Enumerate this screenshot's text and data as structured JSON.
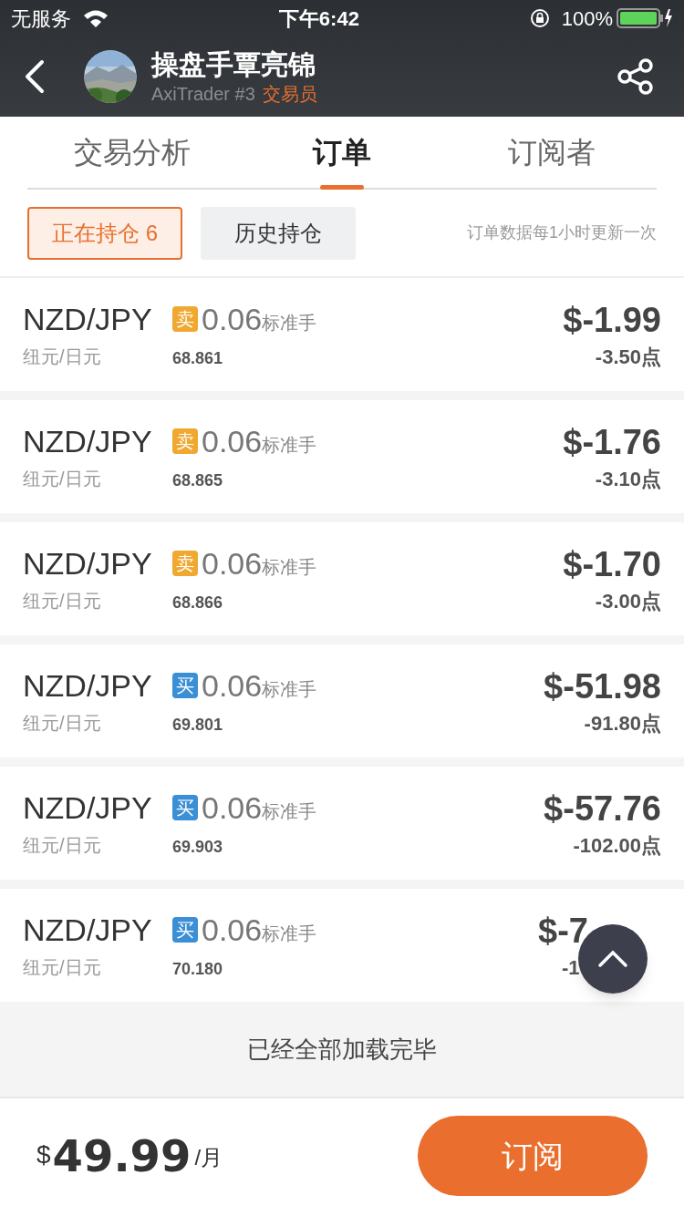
{
  "status_bar": {
    "carrier": "无服务",
    "time": "下午6:42",
    "battery": "100%"
  },
  "header": {
    "title": "操盘手覃亮锦",
    "subtitle": "AxiTrader #3",
    "role": "交易员"
  },
  "tabs": [
    {
      "label": "交易分析",
      "selected": false
    },
    {
      "label": "订单",
      "selected": true
    },
    {
      "label": "订阅者",
      "selected": false
    }
  ],
  "filters": [
    {
      "label": "正在持仓 6",
      "selected": true
    },
    {
      "label": "历史持仓",
      "selected": false
    }
  ],
  "update_note": "订单数据每1小时更新一次",
  "orders": [
    {
      "symbol": "NZD/JPY",
      "name": "纽元/日元",
      "color": "#f0a830",
      "badge": "卖",
      "lots": "0.06",
      "unit": "标准手",
      "price": "68.861",
      "pnl": "$-1.99",
      "points": "-3.50点"
    },
    {
      "symbol": "NZD/JPY",
      "name": "纽元/日元",
      "color": "#f0a830",
      "badge": "卖",
      "lots": "0.06",
      "unit": "标准手",
      "price": "68.865",
      "pnl": "$-1.76",
      "points": "-3.10点"
    },
    {
      "symbol": "NZD/JPY",
      "name": "纽元/日元",
      "color": "#f0a830",
      "badge": "卖",
      "lots": "0.06",
      "unit": "标准手",
      "price": "68.866",
      "pnl": "$-1.70",
      "points": "-3.00点"
    },
    {
      "symbol": "NZD/JPY",
      "name": "纽元/日元",
      "color": "#3b8fd4",
      "badge": "买",
      "lots": "0.06",
      "unit": "标准手",
      "price": "69.801",
      "pnl": "$-51.98",
      "points": "-91.80点"
    },
    {
      "symbol": "NZD/JPY",
      "name": "纽元/日元",
      "color": "#3b8fd4",
      "badge": "买",
      "lots": "0.06",
      "unit": "标准手",
      "price": "69.903",
      "pnl": "$-57.76",
      "points": "-102.00点"
    },
    {
      "symbol": "NZD/JPY",
      "name": "纽元/日元",
      "color": "#3b8fd4",
      "badge": "买",
      "lots": "0.06",
      "unit": "标准手",
      "price": "70.180",
      "pnl": "$-7",
      "points": "-1",
      "obscured": true
    }
  ],
  "list_end": "已经全部加载完毕",
  "footer": {
    "currency": "$",
    "price": "49.99",
    "per": "/月",
    "subscribe": "订阅"
  }
}
